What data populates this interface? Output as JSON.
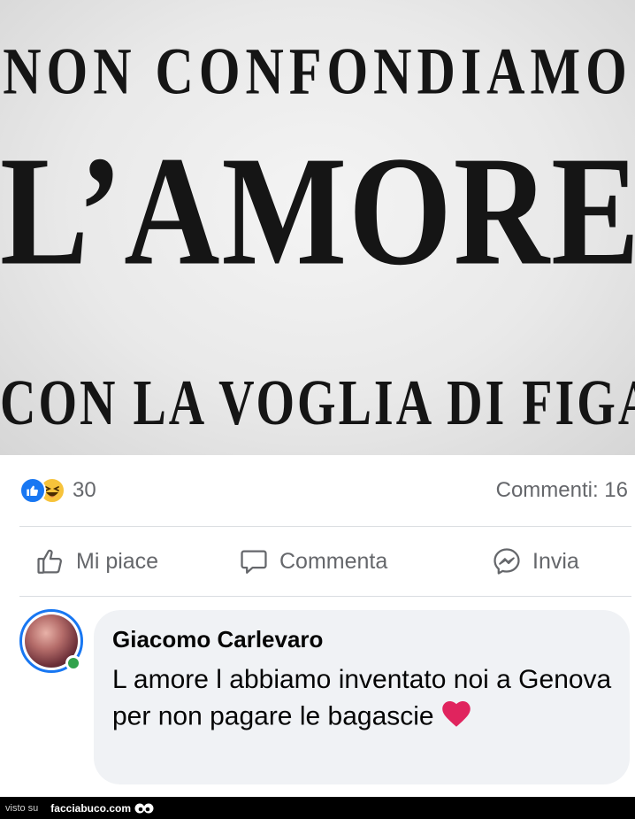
{
  "poster": {
    "line1": "NON CONFONDIAMO",
    "line2": "L’AMORE",
    "line3": "CON LA VOGLIA DI FIGA"
  },
  "reactions": {
    "icons": [
      "like-icon",
      "haha-icon"
    ],
    "count": "30",
    "comments_label": "Commenti: 16"
  },
  "actions": {
    "like": "Mi piace",
    "comment": "Commenta",
    "send": "Invia"
  },
  "comment": {
    "author": "Giacomo Carlevaro",
    "text": "L amore l abbiamo inventato noi a Genova per non pagare le bagascie",
    "emoji": "heart-icon",
    "online": true
  },
  "footer": {
    "visto": "visto su",
    "brand": "facciabuco.com"
  },
  "colors": {
    "facebook_blue": "#1877f2",
    "online_green": "#31a24c",
    "bubble_bg": "#f0f2f5",
    "muted_text": "#65676b",
    "heart_red": "#e0245e"
  }
}
